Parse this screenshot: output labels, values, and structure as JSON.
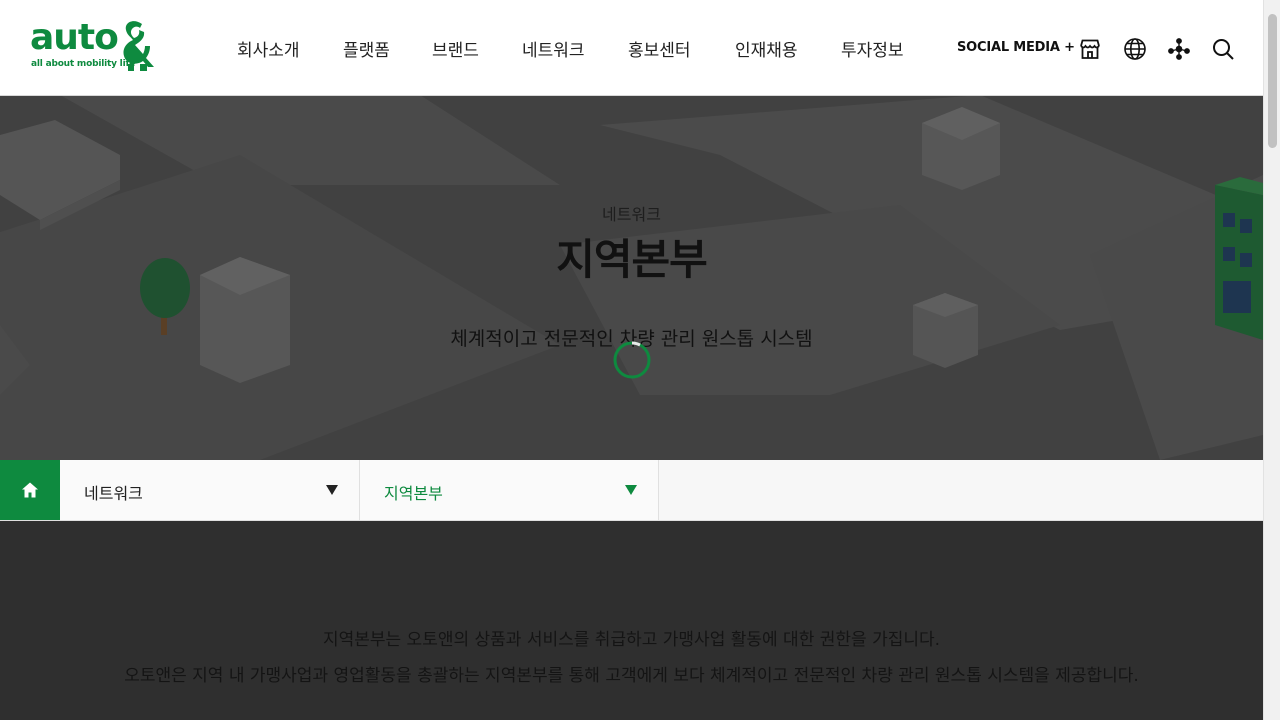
{
  "header": {
    "logo": {
      "word": "auto",
      "tagline": "all about mobility life"
    },
    "nav": [
      {
        "label": "회사소개"
      },
      {
        "label": "플랫폼"
      },
      {
        "label": "브랜드"
      },
      {
        "label": "네트워크"
      },
      {
        "label": "홍보센터"
      },
      {
        "label": "인재채용"
      },
      {
        "label": "투자정보"
      }
    ],
    "social_label": "SOCIAL MEDIA +",
    "icons": [
      "store-icon",
      "globe-icon",
      "sitemap-icon",
      "search-icon"
    ]
  },
  "visual": {
    "subtitle": "네트워크",
    "title": "지역본부",
    "description": "체계적이고 전문적인 차량 관리 원스톱 시스템"
  },
  "location": {
    "depth1": "네트워크",
    "depth2": "지역본부"
  },
  "content": {
    "lines": [
      "지역본부는 오토앤의 상품과 서비스를 취급하고 가맹사업 활동에 대한 권한을 가집니다.",
      "오토앤은 지역 내 가맹사업과 영업활동을 총괄하는 지역본부를 통해 고객에게 보다 체계적이고 전문적인 차량 관리 원스톱 시스템을 제공합니다."
    ]
  },
  "colors": {
    "brand": "#0e8a3f",
    "overlay": "#2f2f2f"
  }
}
